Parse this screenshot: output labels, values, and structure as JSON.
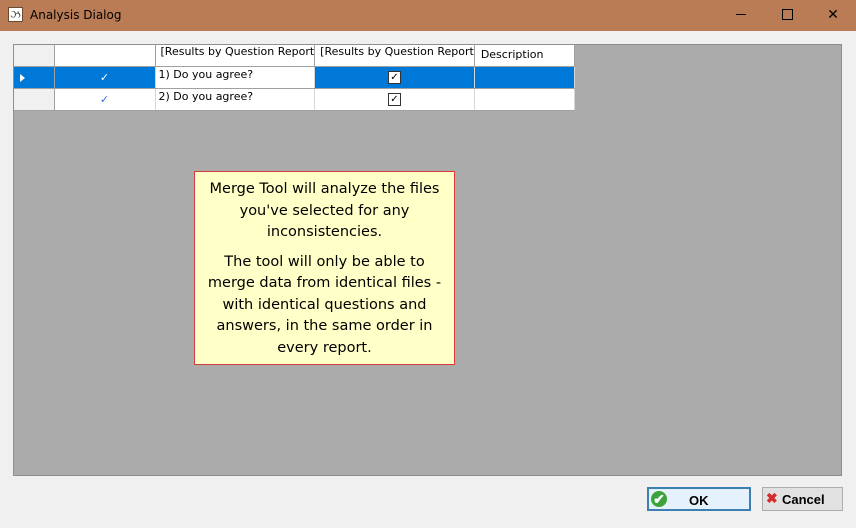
{
  "window": {
    "title": "Analysis Dialog",
    "minimize_glyph": "",
    "close_glyph": "✕"
  },
  "grid": {
    "columns": [
      {
        "label": ""
      },
      {
        "label": "[Results by Question Report"
      },
      {
        "label": "[Results by Question Report"
      },
      {
        "label": "Description"
      }
    ],
    "rows": [
      {
        "selected": true,
        "question": "1) Do you agree?",
        "checked": true,
        "description": ""
      },
      {
        "selected": false,
        "question": "2) Do you agree?",
        "checked": true,
        "description": ""
      }
    ],
    "check_glyph": "✓",
    "checkbox_glyph": "✓"
  },
  "info": {
    "paragraph1": "Merge Tool will analyze the files you've selected for any inconsistencies.",
    "paragraph2": "The tool will only be able to merge data from identical files - with identical questions and answers, in the same order in every report."
  },
  "buttons": {
    "ok_label": "OK",
    "cancel_label": "Cancel",
    "ok_icon": "check-circle-icon",
    "cancel_icon": "red-x-icon"
  },
  "colors": {
    "titlebar": "#b97c55",
    "selection": "#0078d7",
    "info_background": "#ffffc8",
    "info_border": "#d83b3b"
  }
}
